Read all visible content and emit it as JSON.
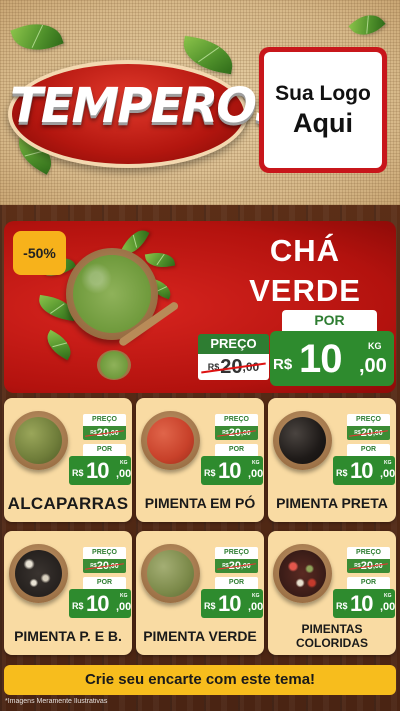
{
  "brand": {
    "logo_text": "TEMPEROS",
    "logo_placeholder_line1": "Sua Logo",
    "logo_placeholder_line2": "Aqui"
  },
  "featured": {
    "discount": "-50%",
    "title_line1": "CHÁ",
    "title_line2": "VERDE",
    "old_label": "PREÇO",
    "old_currency": "R$",
    "old_int": "20",
    "old_dec": ",00",
    "new_label": "POR",
    "new_currency": "R$",
    "new_int": "10",
    "new_dec": ",00",
    "unit": "KG"
  },
  "price_labels": {
    "old": "PREÇO",
    "new": "POR",
    "currency": "R$",
    "unit": "KG"
  },
  "products": [
    {
      "name": "ALCAPARRAS",
      "old_int": "20",
      "old_dec": ",00",
      "new_int": "10",
      "new_dec": ",00",
      "color": "#6f7d3a"
    },
    {
      "name": "PIMENTA EM PÓ",
      "old_int": "20",
      "old_dec": ",00",
      "new_int": "10",
      "new_dec": ",00",
      "color": "#c8412a"
    },
    {
      "name": "PIMENTA PRETA",
      "old_int": "20",
      "old_dec": ",00",
      "new_int": "10",
      "new_dec": ",00",
      "color": "#1e1a18"
    },
    {
      "name": "PIMENTA P. E B.",
      "old_int": "20",
      "old_dec": ",00",
      "new_int": "10",
      "new_dec": ",00",
      "color": "#5a5248"
    },
    {
      "name": "PIMENTA VERDE",
      "old_int": "20",
      "old_dec": ",00",
      "new_int": "10",
      "new_dec": ",00",
      "color": "#7c8a4a"
    },
    {
      "name": "PIMENTAS COLORIDAS",
      "old_int": "20",
      "old_dec": ",00",
      "new_int": "10",
      "new_dec": ",00",
      "color": "#8a3b2e"
    }
  ],
  "footer": {
    "cta": "Crie seu encarte com este tema!",
    "disclaimer": "*Imagens Meramente Ilustrativas"
  },
  "colors": {
    "brand_red": "#c8161b",
    "price_green": "#2e8b2e",
    "badge_yellow": "#f7b21b",
    "card_bg": "#f9dba3"
  }
}
